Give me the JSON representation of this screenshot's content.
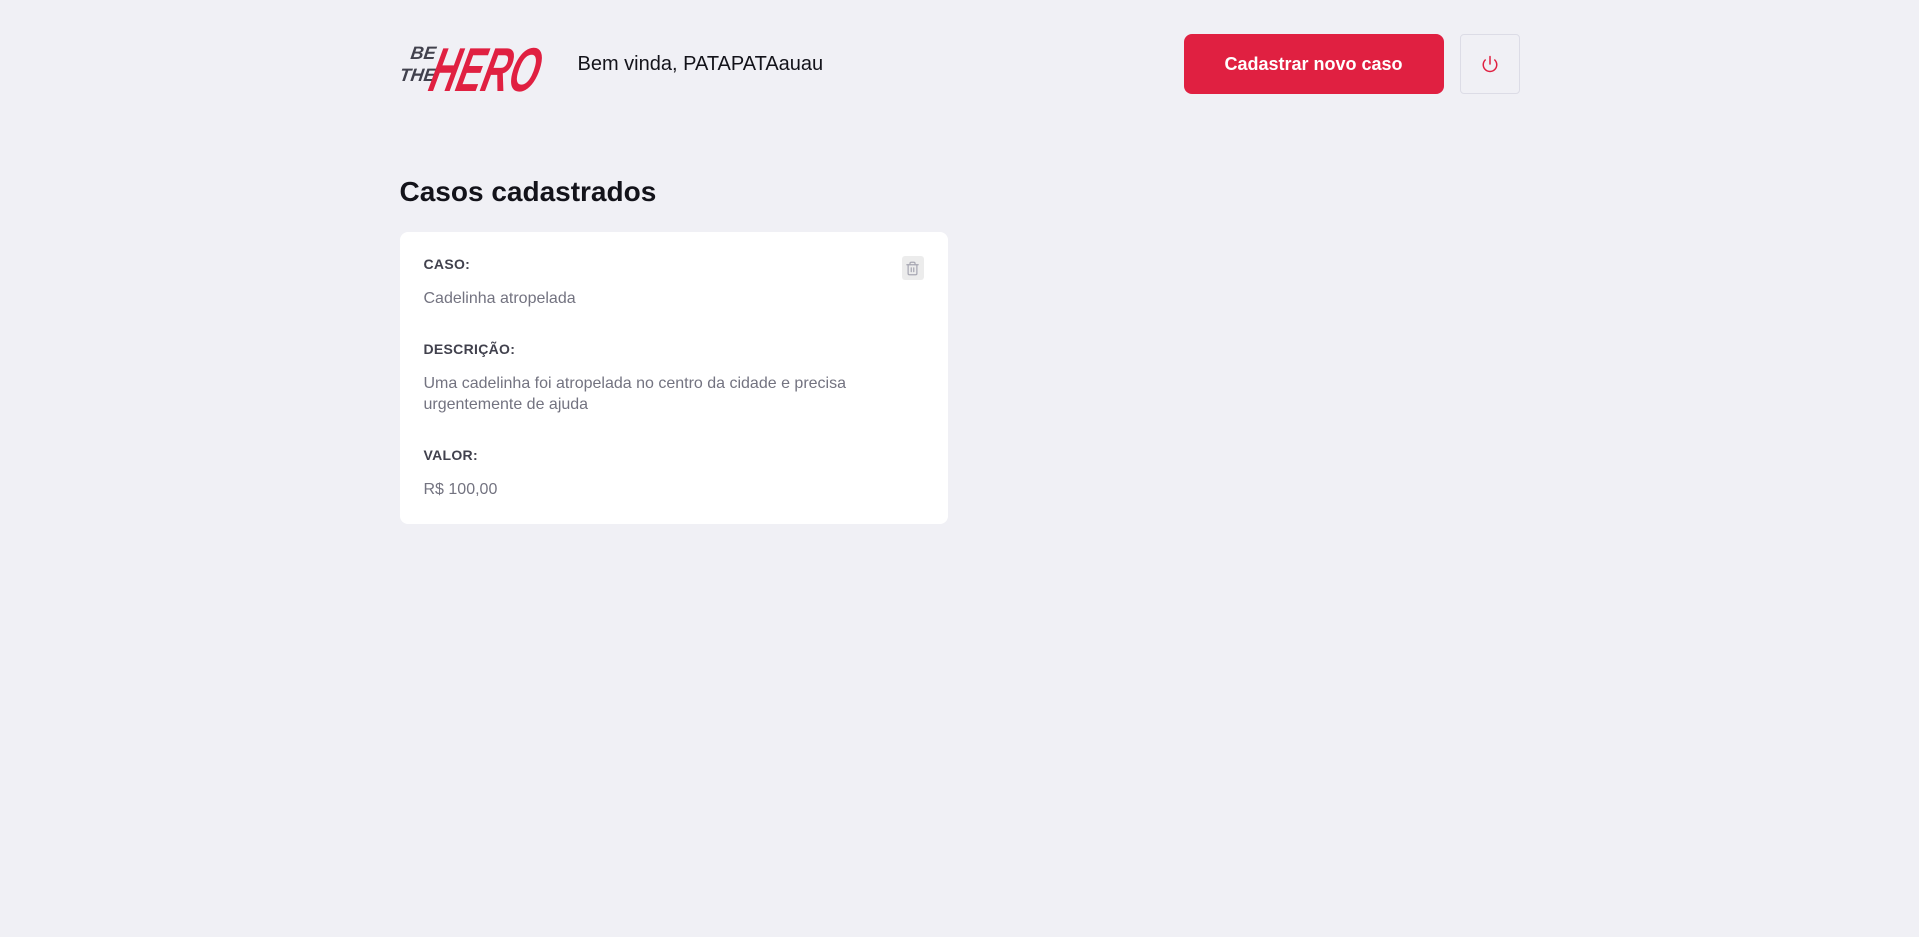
{
  "header": {
    "logo_text": "BE THE HERO",
    "welcome_text": "Bem vinda, PATAPATAauau",
    "new_case_label": "Cadastrar novo caso",
    "logout_icon": "power-icon"
  },
  "main": {
    "title": "Casos cadastrados",
    "cases": [
      {
        "case_label": "CASO:",
        "case_value": "Cadelinha atropelada",
        "description_label": "DESCRIÇÃO:",
        "description_value": "Uma cadelinha foi atropelada no centro da cidade e precisa urgentemente de ajuda",
        "value_label": "VALOR:",
        "value_value": "R$ 100,00",
        "delete_icon": "trash-icon"
      }
    ]
  },
  "colors": {
    "brand": "#e02041",
    "background": "#f0f0f5",
    "card": "#ffffff",
    "label": "#41414d",
    "text_muted": "#737380",
    "logo_dark": "#41414d"
  }
}
